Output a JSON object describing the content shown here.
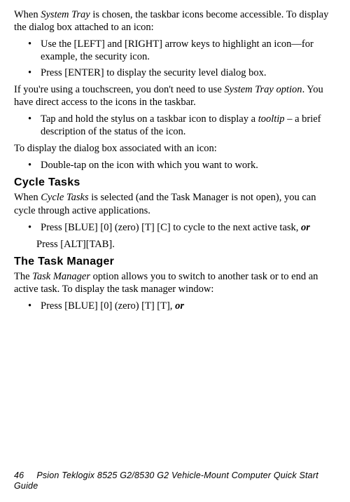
{
  "intro": {
    "p1_a": "When ",
    "p1_b": "System Tray",
    "p1_c": " is chosen, the taskbar icons become accessible. To display the dialog box attached to an icon:",
    "b1": "Use the [LEFT] and [RIGHT] arrow keys to highlight an icon—for example, the security icon.",
    "b2": "Press [ENTER] to display the security level dialog box.",
    "p2_a": "If you're using a touchscreen, you don't need to use ",
    "p2_b": "System Tray option",
    "p2_c": ". You have direct access to the icons in the taskbar.",
    "b3_a": "Tap and hold the stylus on a taskbar icon to display a ",
    "b3_b": "tooltip",
    "b3_c": " – a brief description of the status of the icon.",
    "p3": "To display the dialog box associated with an icon:",
    "b4": "Double-tap on the icon with which you want to work."
  },
  "cycle": {
    "heading": "Cycle Tasks",
    "p1_a": "When ",
    "p1_b": "Cycle Tasks",
    "p1_c": " is selected (and the Task Manager is not open), you can cycle through active applications.",
    "b1_a": "Press [BLUE] [0] (zero) [T] [C] to cycle to the next active task, ",
    "b1_b": "or",
    "b1_cont": "Press [ALT][TAB]."
  },
  "taskmgr": {
    "heading": "The Task Manager",
    "p1_a": "The ",
    "p1_b": "Task Manager",
    "p1_c": " option allows you to switch to another task or to end an active task. To display the task manager window:",
    "b1_a": "Press [BLUE] [0] (zero) [T] [T], ",
    "b1_b": "or"
  },
  "footer": {
    "page": "46",
    "title": "Psion Teklogix 8525 G2/8530 G2 Vehicle-Mount Computer Quick Start Guide"
  }
}
